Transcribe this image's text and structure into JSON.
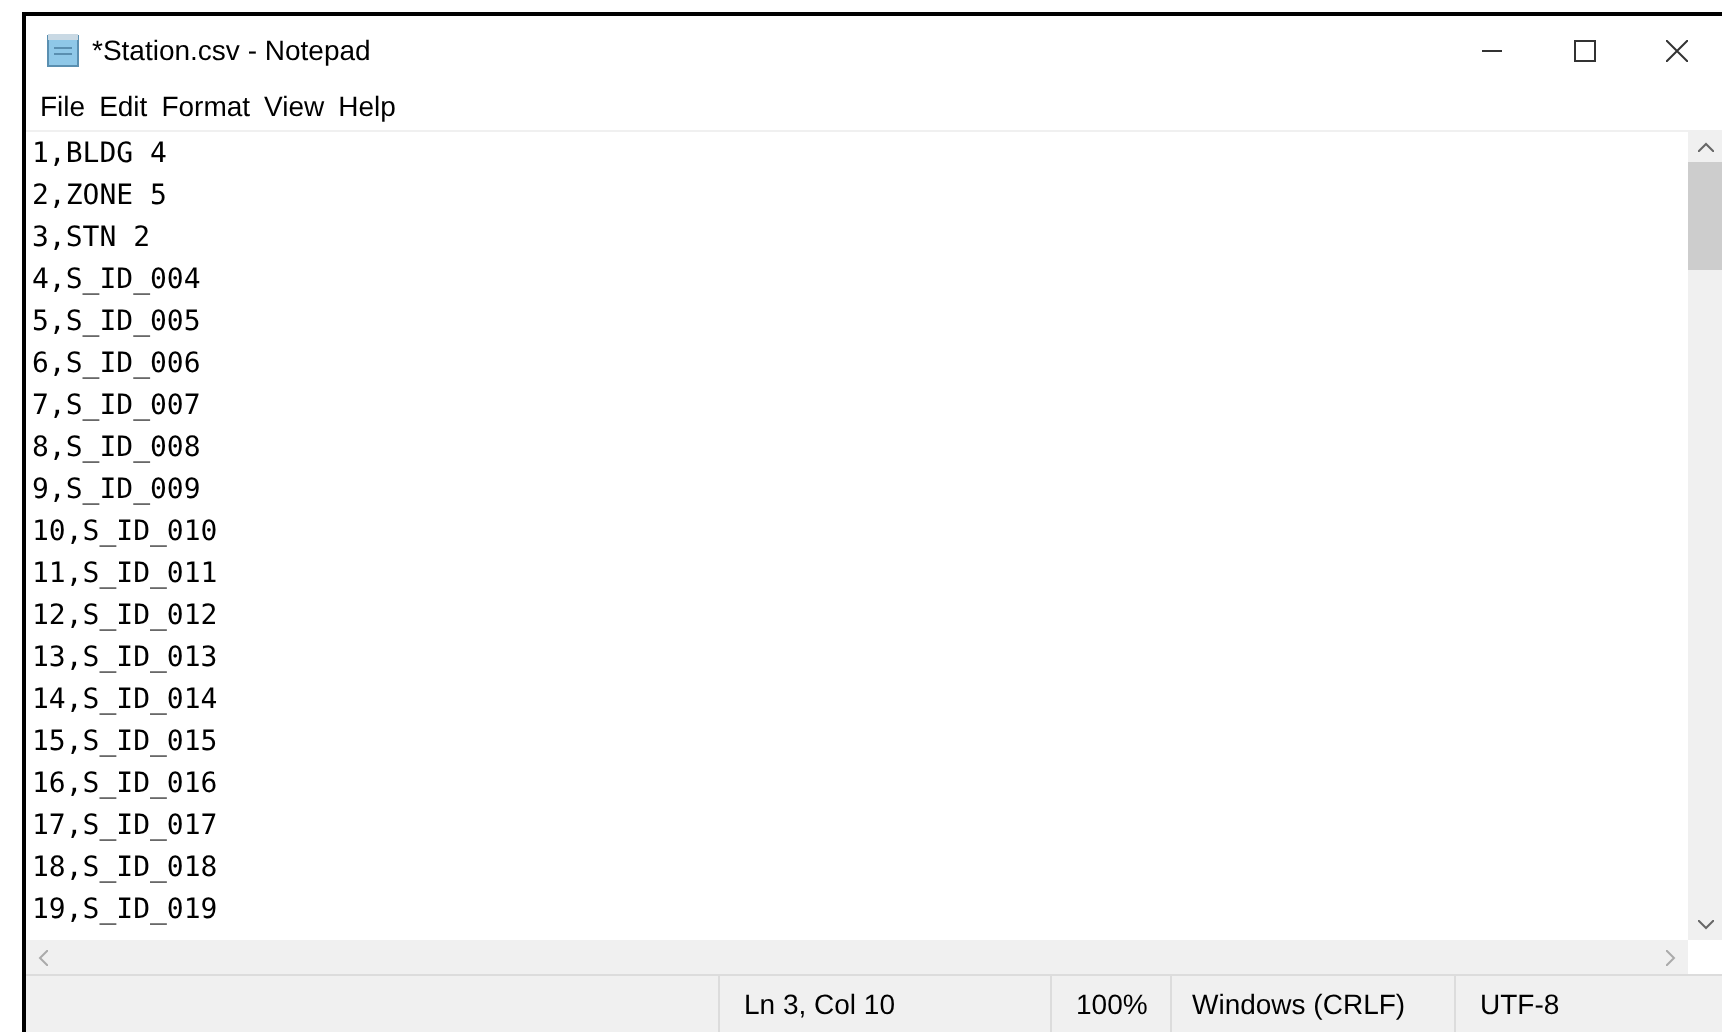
{
  "window": {
    "title": "*Station.csv - Notepad"
  },
  "menu": [
    "File",
    "Edit",
    "Format",
    "View",
    "Help"
  ],
  "lines": [
    "1,BLDG 4",
    "2,ZONE 5",
    "3,STN 2",
    "4,S_ID_004",
    "5,S_ID_005",
    "6,S_ID_006",
    "7,S_ID_007",
    "8,S_ID_008",
    "9,S_ID_009",
    "10,S_ID_010",
    "11,S_ID_011",
    "12,S_ID_012",
    "13,S_ID_013",
    "14,S_ID_014",
    "15,S_ID_015",
    "16,S_ID_016",
    "17,S_ID_017",
    "18,S_ID_018",
    "19,S_ID_019"
  ],
  "status_bar": {
    "position": "Ln 3, Col 10",
    "zoom": "100%",
    "line_ending": "Windows (CRLF)",
    "encoding": "UTF-8"
  }
}
